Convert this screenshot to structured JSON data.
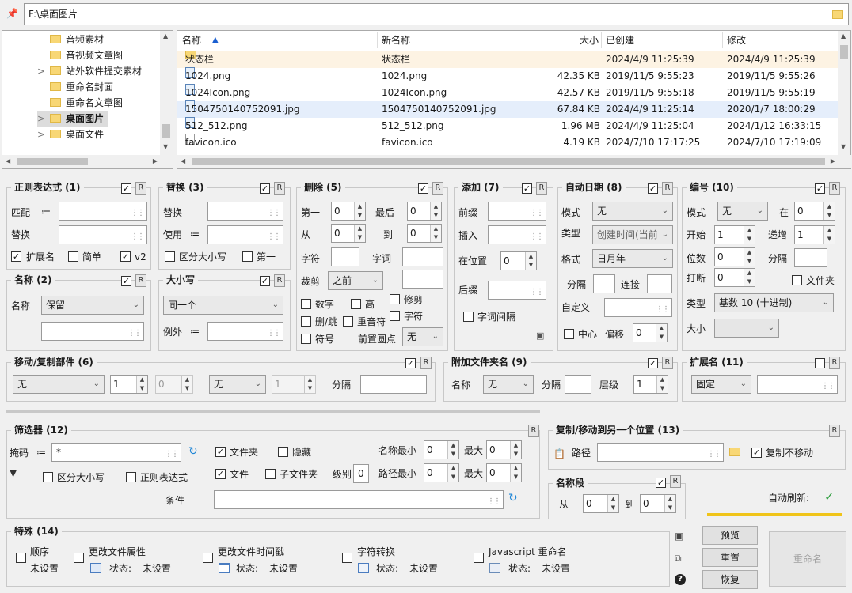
{
  "path_bar": {
    "value": "F:\\桌面图片"
  },
  "tree": [
    {
      "label": "音频素材",
      "expander": ""
    },
    {
      "label": "音视频文章图",
      "expander": ""
    },
    {
      "label": "站外软件提交素材",
      "expander": ">"
    },
    {
      "label": "重命名封面",
      "expander": ""
    },
    {
      "label": "重命名文章图",
      "expander": ""
    },
    {
      "label": "桌面图片",
      "expander": ">"
    },
    {
      "label": "桌面文件",
      "expander": ">"
    }
  ],
  "file_list": {
    "headers": {
      "name": "名称",
      "newname": "新名称",
      "size": "大小",
      "created": "已创建",
      "modified": "修改"
    },
    "rows": [
      {
        "name": "状态栏",
        "newname": "状态栏",
        "size": "",
        "created": "2024/4/9 11:25:39",
        "modified": "2024/4/9 11:25:39",
        "icon": "folder"
      },
      {
        "name": "1024.png",
        "newname": "1024.png",
        "size": "42.35 KB",
        "created": "2019/11/5 9:55:23",
        "modified": "2019/11/5 9:55:26",
        "icon": "image"
      },
      {
        "name": "1024Icon.png",
        "newname": "1024Icon.png",
        "size": "42.57 KB",
        "created": "2019/11/5 9:55:18",
        "modified": "2019/11/5 9:55:19",
        "icon": "image"
      },
      {
        "name": "1504750140752091.jpg",
        "newname": "1504750140752091.jpg",
        "size": "67.84 KB",
        "created": "2024/4/9 11:25:14",
        "modified": "2020/1/7 18:00:29",
        "icon": "image"
      },
      {
        "name": "512_512.png",
        "newname": "512_512.png",
        "size": "1.96 MB",
        "created": "2024/4/9 11:25:04",
        "modified": "2024/1/12 16:33:15",
        "icon": "image"
      },
      {
        "name": "favicon.ico",
        "newname": "favicon.ico",
        "size": "4.19 KB",
        "created": "2024/7/10 17:17:25",
        "modified": "2024/7/10 17:19:09",
        "icon": "doc"
      }
    ]
  },
  "regex": {
    "title": "正则表达式 (1)",
    "match_label": "匹配",
    "replace_label": "替换",
    "ext_label": "扩展名",
    "simple_label": "简单",
    "v2_label": "v2",
    "r": "R"
  },
  "replace": {
    "title": "替换 (3)",
    "replace_label": "替换",
    "use_label": "使用",
    "case_label": "区分大小写",
    "first_label": "第一",
    "r": "R"
  },
  "remove": {
    "title": "删除 (5)",
    "first_label": "第一",
    "first_val": "0",
    "last_label": "最后",
    "last_val": "0",
    "from_label": "从",
    "from_val": "0",
    "to_label": "到",
    "to_val": "0",
    "chars_label": "字符",
    "words_label": "字词",
    "crop_label": "裁剪",
    "crop_val": "之前",
    "digits_label": "数字",
    "high_label": "高",
    "trim_label": "修剪",
    "dsds_label": "删/跳",
    "dup_label": "重音符",
    "chars2_label": "字符",
    "sym_label": "符号",
    "lead_label": "前置圆点",
    "lead_val": "无",
    "r": "R"
  },
  "add": {
    "title": "添加 (7)",
    "prefix_label": "前缀",
    "insert_label": "插入",
    "pos_label": "在位置",
    "pos_val": "0",
    "suffix_label": "后缀",
    "wordspace_label": "字词间隔",
    "r": "R"
  },
  "autodate": {
    "title": "自动日期 (8)",
    "mode_label": "模式",
    "mode_val": "无",
    "type_label": "类型",
    "type_val": "创建时间(当前",
    "format_label": "格式",
    "format_val": "日月年",
    "sep_label": "分隔",
    "conn_label": "连接",
    "custom_label": "自定义",
    "center_label": "中心",
    "offset_label": "偏移",
    "offset_val": "0",
    "r": "R"
  },
  "numbering": {
    "title": "编号 (10)",
    "mode_label": "模式",
    "mode_val": "无",
    "at_label": "在",
    "at_val": "0",
    "start_label": "开始",
    "start_val": "1",
    "inc_label": "递增",
    "inc_val": "1",
    "pad_label": "位数",
    "pad_val": "0",
    "sep_label": "分隔",
    "break_label": "打断",
    "break_val": "0",
    "folder_label": "文件夹",
    "type_label": "类型",
    "type_val": "基数 10 (十进制)",
    "case_label": "大小",
    "r": "R"
  },
  "name": {
    "title": "名称 (2)",
    "name_label": "名称",
    "name_val": "保留",
    "r": "R"
  },
  "case": {
    "title": "大小写",
    "case_val": "同一个",
    "except_label": "例外",
    "r": "R"
  },
  "move": {
    "title": "移动/复制部件 (6)",
    "val1": "无",
    "num1": "1",
    "num2": "0",
    "val2": "无",
    "num3": "1",
    "sep_label": "分隔",
    "r": "R"
  },
  "folder_name": {
    "title": "附加文件夹名 (9)",
    "name_label": "名称",
    "name_val": "无",
    "sep_label": "分隔",
    "level_label": "层级",
    "level_val": "1",
    "r": "R"
  },
  "extension": {
    "title": "扩展名 (11)",
    "val": "固定",
    "r": "R"
  },
  "filter": {
    "title": "筛选器 (12)",
    "mask_label": "掩码",
    "mask_val": "*",
    "folders_label": "文件夹",
    "hidden_label": "隐藏",
    "files_label": "文件",
    "subfolders_label": "子文件夹",
    "case_label": "区分大小写",
    "regex_label": "正则表达式",
    "level_label": "级别",
    "level_val": "0",
    "namemin_label": "名称最小",
    "namemin_val": "0",
    "max_label": "最大",
    "namemax_val": "0",
    "pathmin_label": "路径最小",
    "pathmin_val": "0",
    "pathmax_val": "0",
    "cond_label": "条件",
    "r": "R"
  },
  "copymove": {
    "title": "复制/移动到另一个位置 (13)",
    "path_label": "路径",
    "copy_label": "复制不移动",
    "r": "R"
  },
  "name_seg": {
    "title": "名称段",
    "from_label": "从",
    "from_val": "0",
    "to_label": "到",
    "to_val": "0",
    "r": "R"
  },
  "special": {
    "title": "特殊 (14)",
    "items": [
      {
        "label": "顺序",
        "status_label": "",
        "status_val": "未设置"
      },
      {
        "label": "更改文件属性",
        "status_label": "状态:",
        "status_val": "未设置"
      },
      {
        "label": "更改文件时间戳",
        "status_label": "状态:",
        "status_val": "未设置"
      },
      {
        "label": "字符转换",
        "status_label": "状态:",
        "status_val": "未设置"
      },
      {
        "label": "Javascript 重命名",
        "status_label": "状态:",
        "status_val": "未设置"
      }
    ]
  },
  "autorefresh": {
    "label": "自动刷新:",
    "mark": "✓"
  },
  "buttons": {
    "preview": "预览",
    "reset": "重置",
    "restore": "恢复",
    "rename": "重命名"
  },
  "colors": {
    "accent": "#f0c419",
    "selection": "#e5eefb",
    "folder_row": "#fdf3e3",
    "check_green": "#2e9e3e"
  }
}
